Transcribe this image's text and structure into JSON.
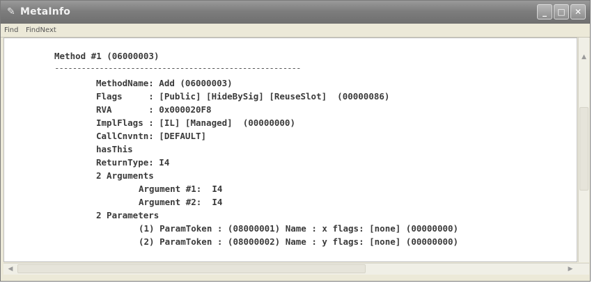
{
  "window": {
    "title": "MetaInfo",
    "icon": "pen-icon",
    "buttons": [
      {
        "name": "minimize",
        "glyph": "_"
      },
      {
        "name": "maximize",
        "glyph": "□"
      },
      {
        "name": "close",
        "glyph": "✕"
      }
    ]
  },
  "menu": {
    "items": [
      "Find",
      "FindNext"
    ]
  },
  "content": {
    "lines": [
      "Method #1 (06000003)",
      "-------------------------------------------------------",
      "MethodName: Add (06000003)",
      "Flags     : [Public] [HideBySig] [ReuseSlot]  (00000086)",
      "RVA       : 0x000020F8",
      "ImplFlags : [IL] [Managed]  (00000000)",
      "CallCnvntn: [DEFAULT]",
      "hasThis",
      "ReturnType: I4",
      "2 Arguments",
      "Argument #1:  I4",
      "Argument #2:  I4",
      "2 Parameters",
      "(1) ParamToken : (08000001) Name : x flags: [none] (00000000)",
      "(2) ParamToken : (08000002) Name : y flags: [none] (00000000)"
    ]
  },
  "colors": {
    "titlebar": "#7d7d7d",
    "window_bg": "#ece9d8",
    "text": "#3a3a3a"
  }
}
